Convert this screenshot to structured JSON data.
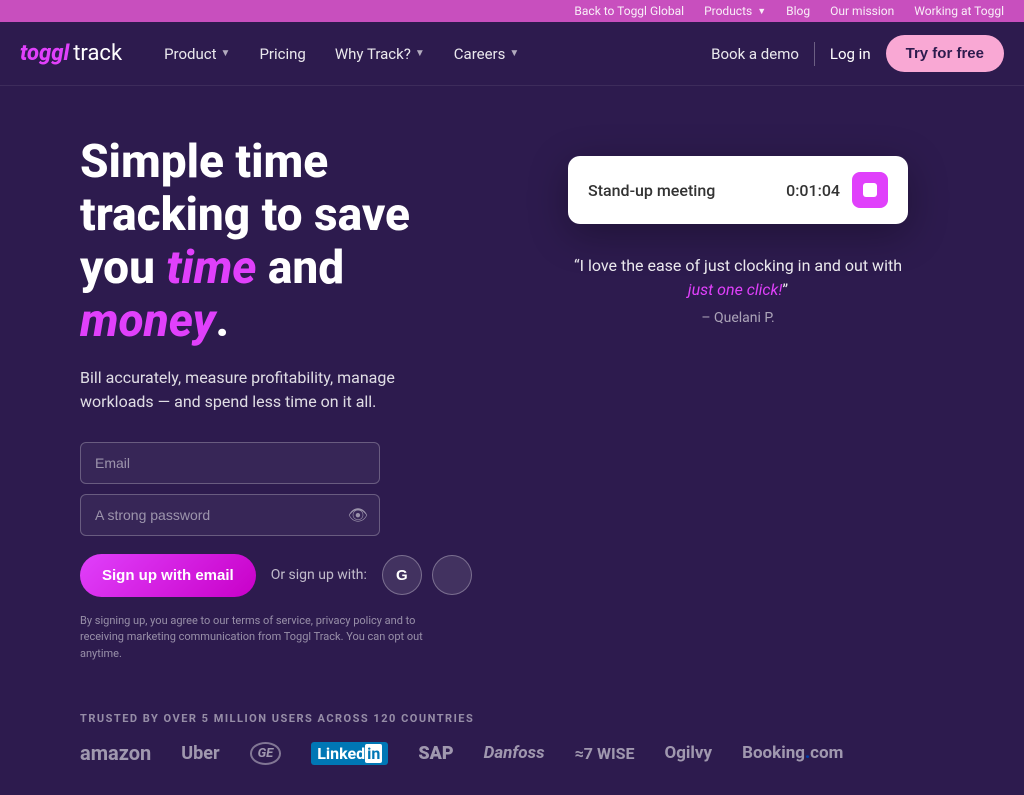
{
  "topbar": {
    "links": [
      {
        "label": "Back to Toggl Global",
        "name": "back-to-toggl-link"
      },
      {
        "label": "Products",
        "name": "products-link"
      },
      {
        "label": "Blog",
        "name": "blog-link"
      },
      {
        "label": "Our mission",
        "name": "our-mission-link"
      },
      {
        "label": "Working at Toggl",
        "name": "working-at-toggl-link"
      }
    ]
  },
  "nav": {
    "logo_toggl": "toggl",
    "logo_track": "track",
    "items": [
      {
        "label": "Product",
        "has_dropdown": true
      },
      {
        "label": "Pricing",
        "has_dropdown": false
      },
      {
        "label": "Why Track?",
        "has_dropdown": true
      },
      {
        "label": "Careers",
        "has_dropdown": true
      }
    ],
    "book_demo": "Book a demo",
    "log_in": "Log in",
    "try_free": "Try for free"
  },
  "hero": {
    "title_prefix": "Simple time tracking to save you ",
    "title_time": "time",
    "title_middle": " and ",
    "title_money": "money",
    "title_suffix": ".",
    "subtitle": "Bill accurately, measure profitability, manage workloads — and spend less time on it all.",
    "email_placeholder": "Email",
    "password_placeholder": "A strong password",
    "signup_btn": "Sign up with email",
    "or_signup": "Or sign up with:",
    "terms": "By signing up, you agree to our terms of service, privacy policy and to receiving marketing communication from Toggl Track. You can opt out anytime."
  },
  "timer_card": {
    "label": "Stand-up meeting",
    "time": "0:01:04"
  },
  "testimonial": {
    "quote_prefix": "“I love the ease of just clocking in and out with ",
    "quote_highlight": "just one click!",
    "quote_suffix": "”",
    "author": "– Quelani P."
  },
  "trusted": {
    "label": "TRUSTED BY OVER 5 MILLION USERS ACROSS 120 COUNTRIES",
    "brands": [
      "amazon",
      "Uber",
      "GE",
      "LinkedIn",
      "SAP",
      "Danfoss",
      "27 WISE",
      "Ogilvy",
      "Booking.com"
    ]
  }
}
